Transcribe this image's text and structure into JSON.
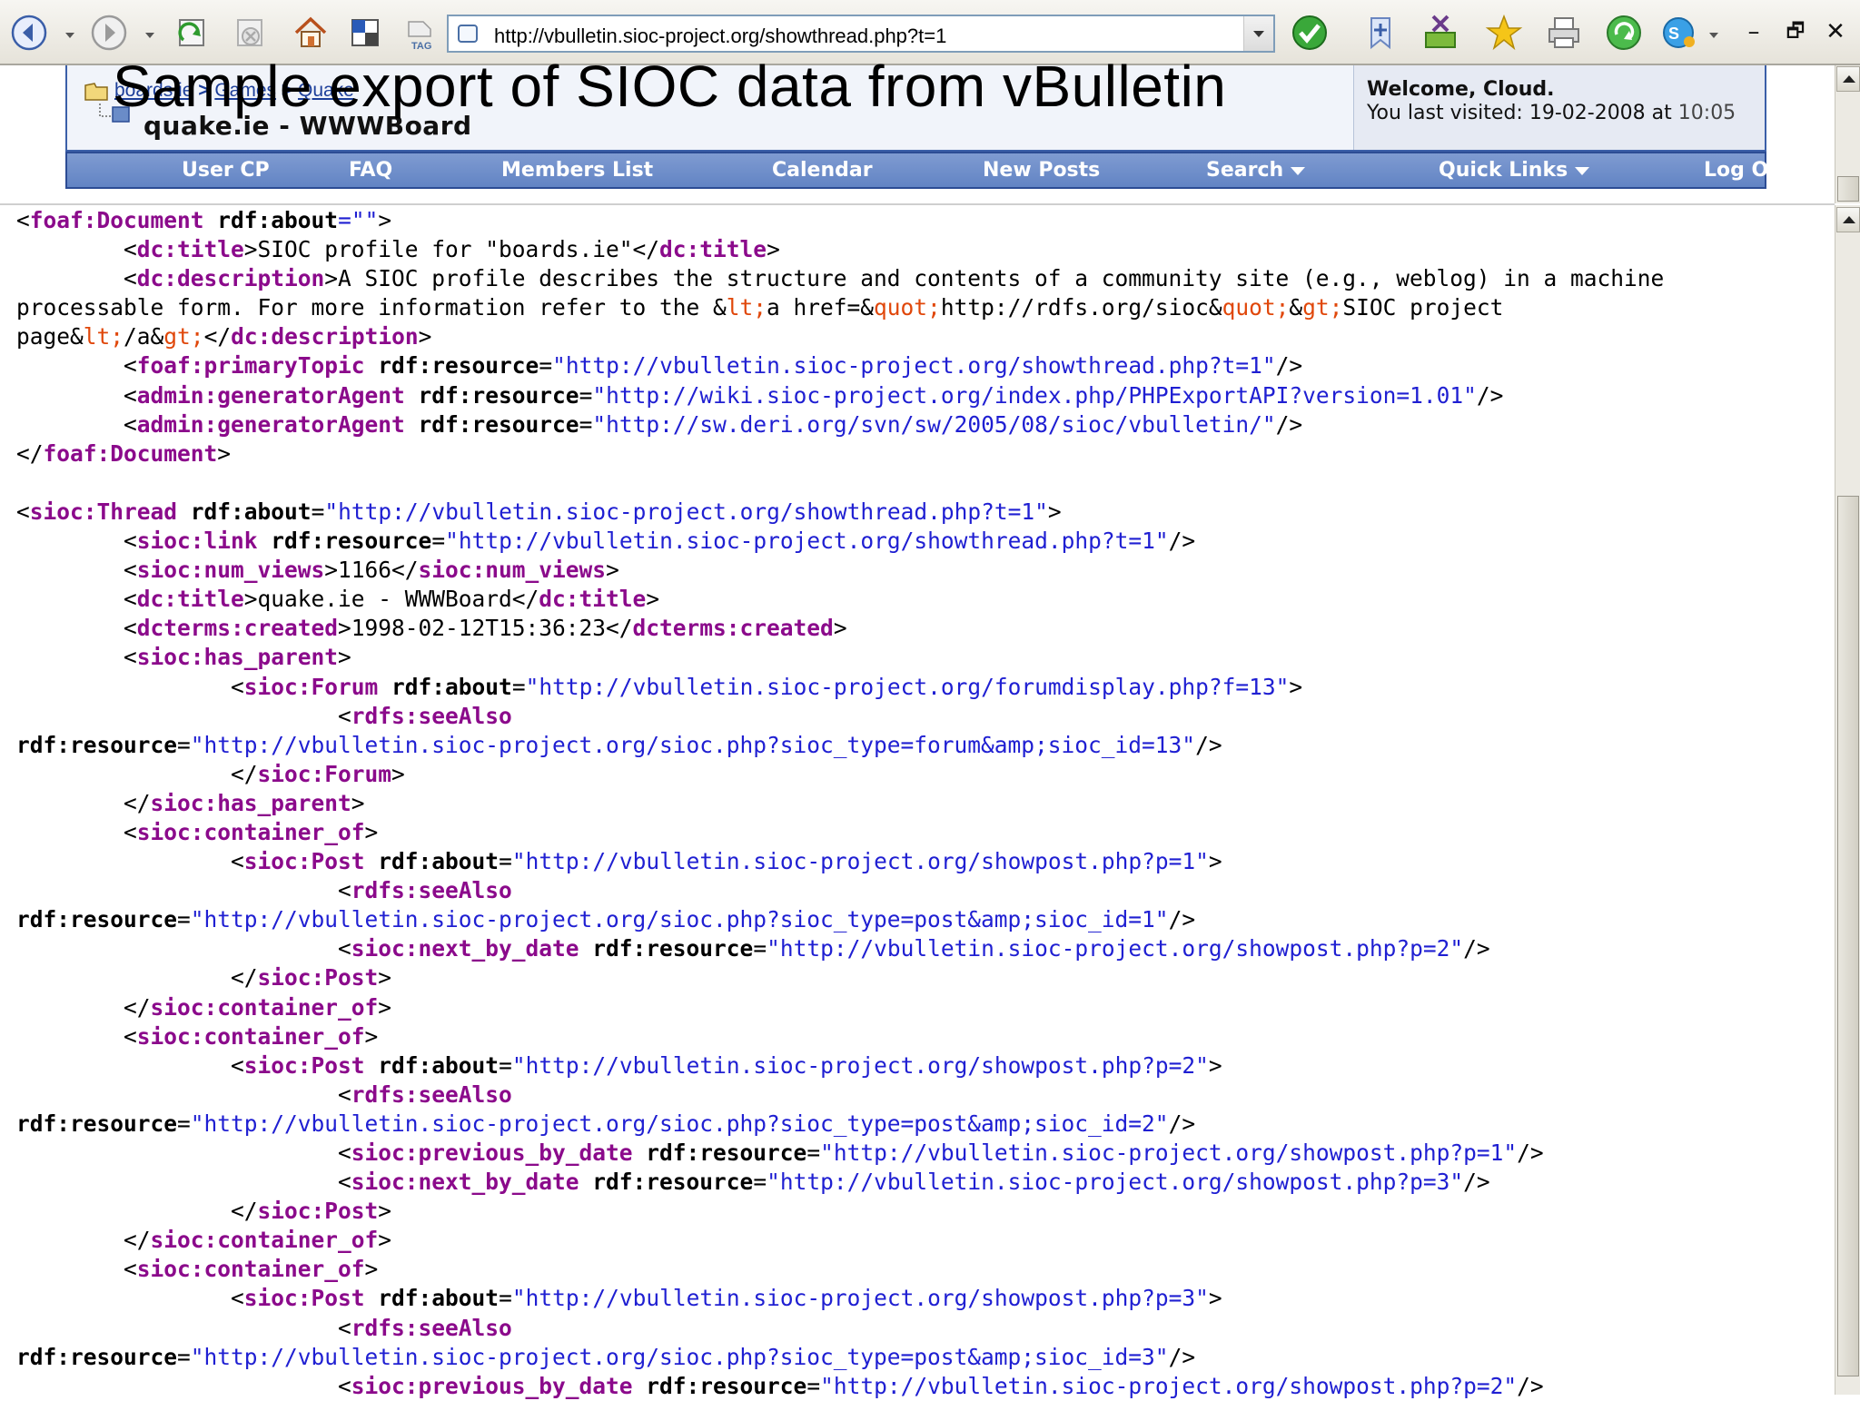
{
  "browser": {
    "url": "http://vbulletin.sioc-project.org/showthread.php?t=1",
    "buttons": [
      "back-icon",
      "forward-icon",
      "refresh-icon",
      "stop-icon",
      "home-icon",
      "tile-icon",
      "tag-icon"
    ],
    "right_icons": [
      "go-check-icon",
      "add-bookmark-icon",
      "download-icon",
      "favorite-star-icon",
      "print-icon",
      "refresh-green-icon",
      "messenger-icon"
    ],
    "window_controls": {
      "minimize": "–",
      "restore": "🗗",
      "close": "✕"
    }
  },
  "slide": {
    "title": "Sample export of SIOC data from vBulletin"
  },
  "forum_header": {
    "breadcrumb_links": [
      "boards.ie",
      "Games",
      "Quake"
    ],
    "breadcrumb_sep": ">",
    "thread_title": "quake.ie - WWWBoard",
    "welcome": "Welcome, Cloud.",
    "last_visited_prefix": "You last visited: 19-02-2008 at ",
    "last_visited_time": "10:05"
  },
  "navbar": {
    "items": [
      {
        "label": "User CP",
        "dropdown": false
      },
      {
        "label": "FAQ",
        "dropdown": false
      },
      {
        "label": "Members List",
        "dropdown": false
      },
      {
        "label": "Calendar",
        "dropdown": false
      },
      {
        "label": "New Posts",
        "dropdown": false
      },
      {
        "label": "Search",
        "dropdown": true
      },
      {
        "label": "Quick Links",
        "dropdown": true
      },
      {
        "label": "Log Out",
        "dropdown": false
      }
    ]
  },
  "colors": {
    "tag": "#8b0a8b",
    "attribute_value": "#1f1fd2",
    "entity": "#e0470a",
    "navbar": "#6f8fcc"
  },
  "xml_lines": [
    [
      [
        "<",
        "tx"
      ],
      [
        "foaf:Document",
        "tg"
      ],
      [
        " ",
        "tx"
      ],
      [
        "rdf:about",
        "at"
      ],
      [
        "=\"\"",
        "vl"
      ],
      [
        ">",
        "tx"
      ]
    ],
    [
      [
        "        <",
        "tx"
      ],
      [
        "dc:title",
        "tg"
      ],
      [
        ">SIOC profile for \"boards.ie\"</",
        "tx"
      ],
      [
        "dc:title",
        "tg"
      ],
      [
        ">",
        "tx"
      ]
    ],
    [
      [
        "        <",
        "tx"
      ],
      [
        "dc:description",
        "tg"
      ],
      [
        ">A SIOC profile describes the structure and contents of a community site (e.g., weblog) in a machine",
        "tx"
      ]
    ],
    [
      [
        "processable form. For more information refer to the &",
        "tx"
      ],
      [
        "lt;",
        "en"
      ],
      [
        "a href=&",
        "tx"
      ],
      [
        "quot;",
        "en"
      ],
      [
        "http://rdfs.org/sioc&",
        "tx"
      ],
      [
        "quot;",
        "en"
      ],
      [
        "&",
        "tx"
      ],
      [
        "gt;",
        "en"
      ],
      [
        "SIOC project",
        "tx"
      ]
    ],
    [
      [
        "page&",
        "tx"
      ],
      [
        "lt;",
        "en"
      ],
      [
        "/a&",
        "tx"
      ],
      [
        "gt;",
        "en"
      ],
      [
        "</",
        "tx"
      ],
      [
        "dc:description",
        "tg"
      ],
      [
        ">",
        "tx"
      ]
    ],
    [
      [
        "        <",
        "tx"
      ],
      [
        "foaf:primaryTopic",
        "tg"
      ],
      [
        " ",
        "tx"
      ],
      [
        "rdf:resource",
        "at"
      ],
      [
        "=",
        "tx"
      ],
      [
        "\"http://vbulletin.sioc-project.org/showthread.php?t=1\"",
        "vl"
      ],
      [
        "/>",
        "tx"
      ]
    ],
    [
      [
        "        <",
        "tx"
      ],
      [
        "admin:generatorAgent",
        "tg"
      ],
      [
        " ",
        "tx"
      ],
      [
        "rdf:resource",
        "at"
      ],
      [
        "=",
        "tx"
      ],
      [
        "\"http://wiki.sioc-project.org/index.php/PHPExportAPI?version=1.01\"",
        "vl"
      ],
      [
        "/>",
        "tx"
      ]
    ],
    [
      [
        "        <",
        "tx"
      ],
      [
        "admin:generatorAgent",
        "tg"
      ],
      [
        " ",
        "tx"
      ],
      [
        "rdf:resource",
        "at"
      ],
      [
        "=",
        "tx"
      ],
      [
        "\"http://sw.deri.org/svn/sw/2005/08/sioc/vbulletin/\"",
        "vl"
      ],
      [
        "/>",
        "tx"
      ]
    ],
    [
      [
        "</",
        "tx"
      ],
      [
        "foaf:Document",
        "tg"
      ],
      [
        ">",
        "tx"
      ]
    ],
    [
      [
        "",
        "tx"
      ]
    ],
    [
      [
        "<",
        "tx"
      ],
      [
        "sioc:Thread",
        "tg"
      ],
      [
        " ",
        "tx"
      ],
      [
        "rdf:about",
        "at"
      ],
      [
        "=",
        "tx"
      ],
      [
        "\"http://vbulletin.sioc-project.org/showthread.php?t=1\"",
        "vl"
      ],
      [
        ">",
        "tx"
      ]
    ],
    [
      [
        "        <",
        "tx"
      ],
      [
        "sioc:link",
        "tg"
      ],
      [
        " ",
        "tx"
      ],
      [
        "rdf:resource",
        "at"
      ],
      [
        "=",
        "tx"
      ],
      [
        "\"http://vbulletin.sioc-project.org/showthread.php?t=1\"",
        "vl"
      ],
      [
        "/>",
        "tx"
      ]
    ],
    [
      [
        "        <",
        "tx"
      ],
      [
        "sioc:num_views",
        "tg"
      ],
      [
        ">1166</",
        "tx"
      ],
      [
        "sioc:num_views",
        "tg"
      ],
      [
        ">",
        "tx"
      ]
    ],
    [
      [
        "        <",
        "tx"
      ],
      [
        "dc:title",
        "tg"
      ],
      [
        ">quake.ie - WWWBoard</",
        "tx"
      ],
      [
        "dc:title",
        "tg"
      ],
      [
        ">",
        "tx"
      ]
    ],
    [
      [
        "        <",
        "tx"
      ],
      [
        "dcterms:created",
        "tg"
      ],
      [
        ">1998-02-12T15:36:23</",
        "tx"
      ],
      [
        "dcterms:created",
        "tg"
      ],
      [
        ">",
        "tx"
      ]
    ],
    [
      [
        "        <",
        "tx"
      ],
      [
        "sioc:has_parent",
        "tg"
      ],
      [
        ">",
        "tx"
      ]
    ],
    [
      [
        "                <",
        "tx"
      ],
      [
        "sioc:Forum",
        "tg"
      ],
      [
        " ",
        "tx"
      ],
      [
        "rdf:about",
        "at"
      ],
      [
        "=",
        "tx"
      ],
      [
        "\"http://vbulletin.sioc-project.org/forumdisplay.php?f=13\"",
        "vl"
      ],
      [
        ">",
        "tx"
      ]
    ],
    [
      [
        "                        <",
        "tx"
      ],
      [
        "rdfs:seeAlso",
        "tg"
      ]
    ],
    [
      [
        "rdf:resource",
        "at"
      ],
      [
        "=",
        "tx"
      ],
      [
        "\"http://vbulletin.sioc-project.org/sioc.php?sioc_type=forum&amp;sioc_id=13\"",
        "vl"
      ],
      [
        "/>",
        "tx"
      ]
    ],
    [
      [
        "                </",
        "tx"
      ],
      [
        "sioc:Forum",
        "tg"
      ],
      [
        ">",
        "tx"
      ]
    ],
    [
      [
        "        </",
        "tx"
      ],
      [
        "sioc:has_parent",
        "tg"
      ],
      [
        ">",
        "tx"
      ]
    ],
    [
      [
        "        <",
        "tx"
      ],
      [
        "sioc:container_of",
        "tg"
      ],
      [
        ">",
        "tx"
      ]
    ],
    [
      [
        "                <",
        "tx"
      ],
      [
        "sioc:Post",
        "tg"
      ],
      [
        " ",
        "tx"
      ],
      [
        "rdf:about",
        "at"
      ],
      [
        "=",
        "tx"
      ],
      [
        "\"http://vbulletin.sioc-project.org/showpost.php?p=1\"",
        "vl"
      ],
      [
        ">",
        "tx"
      ]
    ],
    [
      [
        "                        <",
        "tx"
      ],
      [
        "rdfs:seeAlso",
        "tg"
      ]
    ],
    [
      [
        "rdf:resource",
        "at"
      ],
      [
        "=",
        "tx"
      ],
      [
        "\"http://vbulletin.sioc-project.org/sioc.php?sioc_type=post&amp;sioc_id=1\"",
        "vl"
      ],
      [
        "/>",
        "tx"
      ]
    ],
    [
      [
        "                        <",
        "tx"
      ],
      [
        "sioc:next_by_date",
        "tg"
      ],
      [
        " ",
        "tx"
      ],
      [
        "rdf:resource",
        "at"
      ],
      [
        "=",
        "tx"
      ],
      [
        "\"http://vbulletin.sioc-project.org/showpost.php?p=2\"",
        "vl"
      ],
      [
        "/>",
        "tx"
      ]
    ],
    [
      [
        "                </",
        "tx"
      ],
      [
        "sioc:Post",
        "tg"
      ],
      [
        ">",
        "tx"
      ]
    ],
    [
      [
        "        </",
        "tx"
      ],
      [
        "sioc:container_of",
        "tg"
      ],
      [
        ">",
        "tx"
      ]
    ],
    [
      [
        "        <",
        "tx"
      ],
      [
        "sioc:container_of",
        "tg"
      ],
      [
        ">",
        "tx"
      ]
    ],
    [
      [
        "                <",
        "tx"
      ],
      [
        "sioc:Post",
        "tg"
      ],
      [
        " ",
        "tx"
      ],
      [
        "rdf:about",
        "at"
      ],
      [
        "=",
        "tx"
      ],
      [
        "\"http://vbulletin.sioc-project.org/showpost.php?p=2\"",
        "vl"
      ],
      [
        ">",
        "tx"
      ]
    ],
    [
      [
        "                        <",
        "tx"
      ],
      [
        "rdfs:seeAlso",
        "tg"
      ]
    ],
    [
      [
        "rdf:resource",
        "at"
      ],
      [
        "=",
        "tx"
      ],
      [
        "\"http://vbulletin.sioc-project.org/sioc.php?sioc_type=post&amp;sioc_id=2\"",
        "vl"
      ],
      [
        "/>",
        "tx"
      ]
    ],
    [
      [
        "                        <",
        "tx"
      ],
      [
        "sioc:previous_by_date",
        "tg"
      ],
      [
        " ",
        "tx"
      ],
      [
        "rdf:resource",
        "at"
      ],
      [
        "=",
        "tx"
      ],
      [
        "\"http://vbulletin.sioc-project.org/showpost.php?p=1\"",
        "vl"
      ],
      [
        "/>",
        "tx"
      ]
    ],
    [
      [
        "                        <",
        "tx"
      ],
      [
        "sioc:next_by_date",
        "tg"
      ],
      [
        " ",
        "tx"
      ],
      [
        "rdf:resource",
        "at"
      ],
      [
        "=",
        "tx"
      ],
      [
        "\"http://vbulletin.sioc-project.org/showpost.php?p=3\"",
        "vl"
      ],
      [
        "/>",
        "tx"
      ]
    ],
    [
      [
        "                </",
        "tx"
      ],
      [
        "sioc:Post",
        "tg"
      ],
      [
        ">",
        "tx"
      ]
    ],
    [
      [
        "        </",
        "tx"
      ],
      [
        "sioc:container_of",
        "tg"
      ],
      [
        ">",
        "tx"
      ]
    ],
    [
      [
        "        <",
        "tx"
      ],
      [
        "sioc:container_of",
        "tg"
      ],
      [
        ">",
        "tx"
      ]
    ],
    [
      [
        "                <",
        "tx"
      ],
      [
        "sioc:Post",
        "tg"
      ],
      [
        " ",
        "tx"
      ],
      [
        "rdf:about",
        "at"
      ],
      [
        "=",
        "tx"
      ],
      [
        "\"http://vbulletin.sioc-project.org/showpost.php?p=3\"",
        "vl"
      ],
      [
        ">",
        "tx"
      ]
    ],
    [
      [
        "                        <",
        "tx"
      ],
      [
        "rdfs:seeAlso",
        "tg"
      ]
    ],
    [
      [
        "rdf:resource",
        "at"
      ],
      [
        "=",
        "tx"
      ],
      [
        "\"http://vbulletin.sioc-project.org/sioc.php?sioc_type=post&amp;sioc_id=3\"",
        "vl"
      ],
      [
        "/>",
        "tx"
      ]
    ],
    [
      [
        "                        <",
        "tx"
      ],
      [
        "sioc:previous_by_date",
        "tg"
      ],
      [
        " ",
        "tx"
      ],
      [
        "rdf:resource",
        "at"
      ],
      [
        "=",
        "tx"
      ],
      [
        "\"http://vbulletin.sioc-project.org/showpost.php?p=2\"",
        "vl"
      ],
      [
        "/>",
        "tx"
      ]
    ]
  ]
}
